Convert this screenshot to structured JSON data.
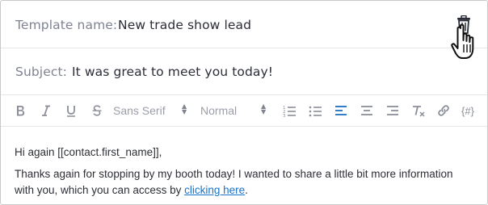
{
  "template": {
    "label": "Template name:",
    "value": "New trade show lead"
  },
  "subject": {
    "label": "Subject:",
    "value": "It was great to meet you today!"
  },
  "toolbar": {
    "font_family": "Sans Serif",
    "font_size": "Normal",
    "placeholder_label": "{#}",
    "active_color": "#1a6fc4"
  },
  "editor": {
    "greeting": "Hi again [[contact.first_name]],",
    "body_line1": "Thanks again for stopping by my booth today! I wanted to share a little bit more information",
    "body_line2_prefix": "with you, which you can access by ",
    "body_link": "clicking here",
    "body_line2_suffix": "."
  },
  "icons": [
    "trash-icon",
    "hand-cursor-icon",
    "bold-icon",
    "italic-icon",
    "underline-icon",
    "strikethrough-icon",
    "ordered-list-icon",
    "bullet-list-icon",
    "align-left-icon",
    "align-center-icon",
    "align-right-icon",
    "clear-formatting-icon",
    "link-icon"
  ]
}
